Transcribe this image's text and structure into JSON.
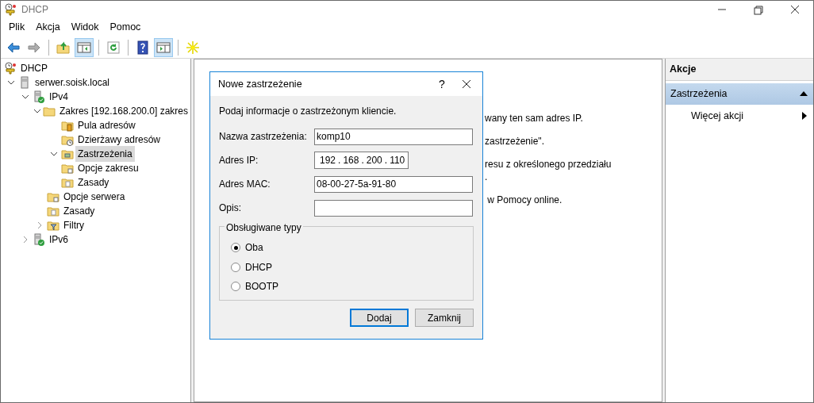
{
  "window": {
    "title": "DHCP"
  },
  "menu": [
    "Plik",
    "Akcja",
    "Widok",
    "Pomoc"
  ],
  "toolbar": [
    {
      "kind": "back",
      "disabled": false,
      "pressed": false
    },
    {
      "kind": "forward",
      "disabled": true,
      "pressed": false
    },
    {
      "kind": "separator"
    },
    {
      "kind": "up",
      "disabled": false,
      "pressed": false
    },
    {
      "kind": "tree-toggle",
      "disabled": false,
      "pressed": true
    },
    {
      "kind": "separator"
    },
    {
      "kind": "refresh",
      "disabled": false,
      "pressed": false
    },
    {
      "kind": "separator"
    },
    {
      "kind": "help",
      "disabled": false,
      "pressed": false
    },
    {
      "kind": "pane-toggle",
      "disabled": false,
      "pressed": true
    },
    {
      "kind": "separator"
    },
    {
      "kind": "new",
      "disabled": false,
      "pressed": false
    }
  ],
  "tree": [
    {
      "label": "DHCP",
      "kind": "dhcp",
      "selected": false,
      "children": [
        {
          "label": "serwer.soisk.local",
          "kind": "server",
          "selected": false,
          "expanded": true,
          "children": [
            {
              "label": "IPv4",
              "kind": "ip",
              "selected": false,
              "expanded": true,
              "children": [
                {
                  "label": "Zakres [192.168.200.0] zakres",
                  "kind": "folder",
                  "selected": false,
                  "expanded": true,
                  "children": [
                    {
                      "label": "Pula adresów",
                      "kind": "pool",
                      "selected": false
                    },
                    {
                      "label": "Dzierżawy adresów",
                      "kind": "lease",
                      "selected": false
                    },
                    {
                      "label": "Zastrzeżenia",
                      "kind": "reservation",
                      "selected": true,
                      "expanded": true
                    },
                    {
                      "label": "Opcje zakresu",
                      "kind": "options",
                      "selected": false
                    },
                    {
                      "label": "Zasady",
                      "kind": "policy",
                      "selected": false
                    }
                  ]
                },
                {
                  "label": "Opcje serwera",
                  "kind": "options",
                  "selected": false
                },
                {
                  "label": "Zasady",
                  "kind": "policy",
                  "selected": false
                },
                {
                  "label": "Filtry",
                  "kind": "filter",
                  "selected": false,
                  "expanded": false
                }
              ]
            },
            {
              "label": "IPv6",
              "kind": "ip",
              "selected": false,
              "expanded": false
            }
          ]
        }
      ]
    }
  ],
  "center": {
    "paragraphs": [
      [
        "wany ten sam adres IP."
      ],
      [
        "zastrzeżenie\"."
      ],
      [
        "resu z określonego przedziału",
        "."
      ],
      [
        " w Pomocy online."
      ]
    ]
  },
  "actions": {
    "title": "Akcje",
    "section": {
      "label": "Zastrzeżenia",
      "expanded": true
    },
    "items": [
      {
        "label": "Więcej akcji",
        "submenu": true
      }
    ]
  },
  "dialog": {
    "title": "Nowe zastrzeżenie",
    "help": "?",
    "intro": "Podaj informacje o zastrzeżonym kliencie.",
    "fields": [
      {
        "label": "Nazwa zastrzeżenia:",
        "kind": "text",
        "value": "komp10"
      },
      {
        "label": "Adres IP:",
        "kind": "ip",
        "octets": [
          "192",
          "168",
          "200",
          "110"
        ],
        "separator": "."
      },
      {
        "label": "Adres MAC:",
        "kind": "text",
        "value": "08-00-27-5a-91-80"
      },
      {
        "label": "Opis:",
        "kind": "text"
      }
    ],
    "group": {
      "label": "Obsługiwane typy",
      "options": [
        {
          "label": "Oba",
          "selected": true
        },
        {
          "label": "DHCP",
          "selected": false
        },
        {
          "label": "BOOTP",
          "selected": false
        }
      ]
    },
    "buttons": [
      "Dodaj",
      "Zamknij"
    ]
  }
}
